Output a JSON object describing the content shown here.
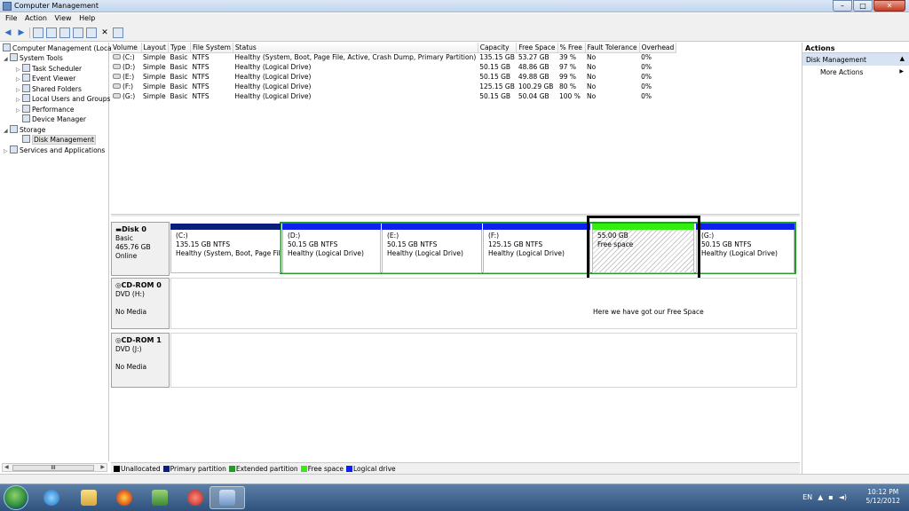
{
  "window": {
    "title": "Computer Management",
    "min": "–",
    "max": "□",
    "close": "✕"
  },
  "menu": [
    "File",
    "Action",
    "View",
    "Help"
  ],
  "toolbar": {
    "back": "◀",
    "fwd": "▶",
    "del": "✕"
  },
  "tree": {
    "root": "Computer Management (Local",
    "system_tools": "System Tools",
    "task_scheduler": "Task Scheduler",
    "event_viewer": "Event Viewer",
    "shared_folders": "Shared Folders",
    "local_users": "Local Users and Groups",
    "performance": "Performance",
    "device_manager": "Device Manager",
    "storage": "Storage",
    "disk_management": "Disk Management",
    "services": "Services and Applications",
    "scroll_thumb": "III"
  },
  "volumes": {
    "headers": [
      "Volume",
      "Layout",
      "Type",
      "File System",
      "Status",
      "Capacity",
      "Free Space",
      "% Free",
      "Fault Tolerance",
      "Overhead"
    ],
    "rows": [
      [
        "(C:)",
        "Simple",
        "Basic",
        "NTFS",
        "Healthy (System, Boot, Page File, Active, Crash Dump, Primary Partition)",
        "135.15 GB",
        "53.27 GB",
        "39 %",
        "No",
        "0%"
      ],
      [
        "(D:)",
        "Simple",
        "Basic",
        "NTFS",
        "Healthy (Logical Drive)",
        "50.15 GB",
        "48.86 GB",
        "97 %",
        "No",
        "0%"
      ],
      [
        "(E:)",
        "Simple",
        "Basic",
        "NTFS",
        "Healthy (Logical Drive)",
        "50.15 GB",
        "49.88 GB",
        "99 %",
        "No",
        "0%"
      ],
      [
        "(F:)",
        "Simple",
        "Basic",
        "NTFS",
        "Healthy (Logical Drive)",
        "125.15 GB",
        "100.29 GB",
        "80 %",
        "No",
        "0%"
      ],
      [
        "(G:)",
        "Simple",
        "Basic",
        "NTFS",
        "Healthy (Logical Drive)",
        "50.15 GB",
        "50.04 GB",
        "100 %",
        "No",
        "0%"
      ]
    ]
  },
  "disk0": {
    "name": "Disk 0",
    "type": "Basic",
    "size": "465.76 GB",
    "state": "Online",
    "partitions": [
      {
        "letter": "(C:)",
        "size": "135.15 GB NTFS",
        "status": "Healthy (System, Boot, Page File, A"
      },
      {
        "letter": "(D:)",
        "size": "50.15 GB NTFS",
        "status": "Healthy (Logical Drive)"
      },
      {
        "letter": "(E:)",
        "size": "50.15 GB NTFS",
        "status": "Healthy (Logical Drive)"
      },
      {
        "letter": "(F:)",
        "size": "125.15 GB NTFS",
        "status": "Healthy (Logical Drive)"
      },
      {
        "letter": "",
        "size": "55.00 GB",
        "status": "Free space"
      },
      {
        "letter": "(G:)",
        "size": "50.15 GB NTFS",
        "status": "Healthy (Logical Drive)"
      }
    ]
  },
  "cdrom0": {
    "name": "CD-ROM 0",
    "drive": "DVD (H:)",
    "media": "No Media"
  },
  "cdrom1": {
    "name": "CD-ROM 1",
    "drive": "DVD (J:)",
    "media": "No Media"
  },
  "annotation": "Here we have got our Free Space",
  "legend": {
    "unallocated": "Unallocated",
    "primary": "Primary partition",
    "extended": "Extended partition",
    "free": "Free space",
    "logical": "Logical drive",
    "colors": {
      "unallocated": "#000000",
      "primary": "#0b1f7a",
      "extended": "#239b2b",
      "free": "#33ee11",
      "logical": "#1020ee"
    }
  },
  "actions": {
    "title": "Actions",
    "section": "Disk Management",
    "more": "More Actions"
  },
  "tray": {
    "lang": "EN",
    "time": "10:12 PM",
    "date": "5/12/2012"
  }
}
